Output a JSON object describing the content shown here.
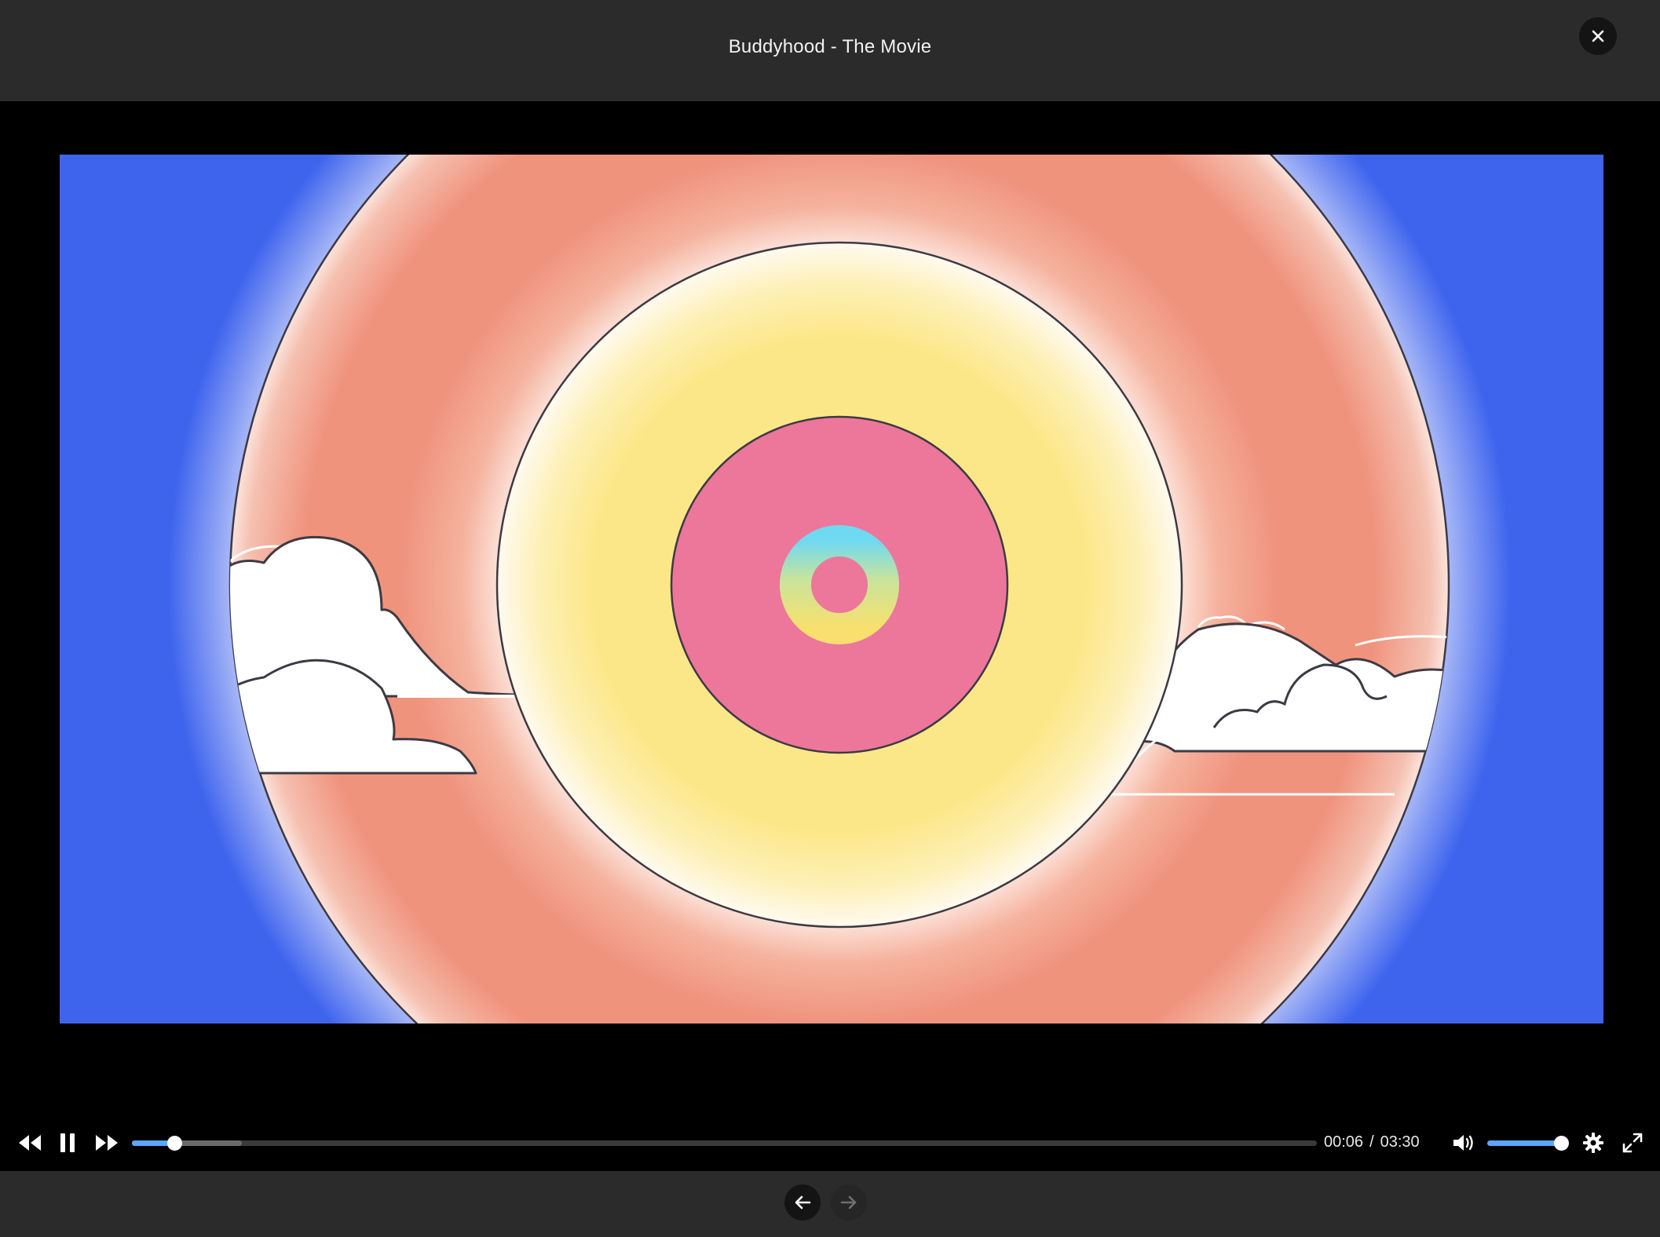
{
  "header": {
    "title": "Buddyhood - The Movie",
    "close_icon": "close-icon"
  },
  "video": {
    "description_colors": {
      "sky": "#3e64ee",
      "outer_disc": "#f0937d",
      "middle_disc": "#fce788",
      "inner_disc": "#ec779b",
      "ring_top": "#73d8f0",
      "ring_bottom": "#f8e070"
    }
  },
  "controls": {
    "rewind_icon": "rewind-icon",
    "pause_icon": "pause-icon",
    "forward_icon": "fast-forward-icon",
    "current_time": "00:06",
    "separator": "/",
    "duration": "03:30",
    "progress_fraction": 0.036,
    "buffered_fraction": 0.093,
    "volume_icon": "volume-icon",
    "volume_fraction": 1.0,
    "settings_icon": "gear-icon",
    "fullscreen_icon": "fullscreen-icon",
    "accent_color": "#5aa7ff"
  },
  "footer": {
    "prev_icon": "arrow-left-icon",
    "next_icon": "arrow-right-icon",
    "next_disabled": true
  }
}
